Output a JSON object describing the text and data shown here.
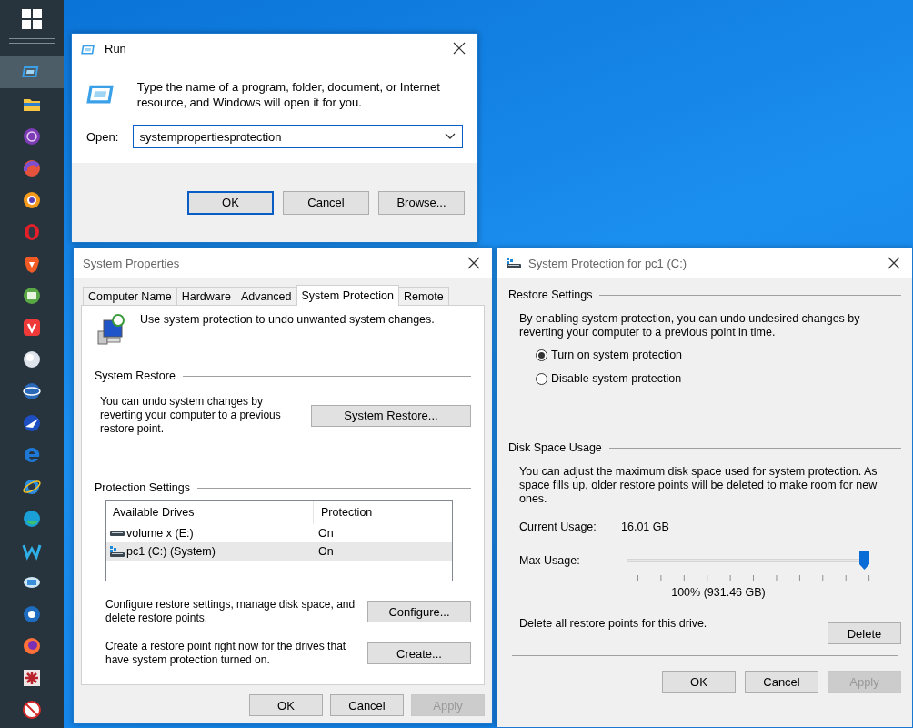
{
  "taskbar": {
    "items": [
      {
        "kind": "run",
        "selected": true
      },
      {
        "kind": "folder",
        "selected": false
      },
      {
        "kind": "tor",
        "selected": false
      },
      {
        "kind": "swirl",
        "selected": false
      },
      {
        "kind": "shield",
        "selected": false
      },
      {
        "kind": "opera",
        "selected": false
      },
      {
        "kind": "brave",
        "selected": false
      },
      {
        "kind": "tray",
        "selected": false
      },
      {
        "kind": "vivaldi",
        "selected": false
      },
      {
        "kind": "sphere",
        "selected": false
      },
      {
        "kind": "globe",
        "selected": false
      },
      {
        "kind": "plane",
        "selected": false
      },
      {
        "kind": "edge-old",
        "selected": false
      },
      {
        "kind": "ie",
        "selected": false
      },
      {
        "kind": "edge",
        "selected": false
      },
      {
        "kind": "w",
        "selected": false
      },
      {
        "kind": "disk",
        "selected": false
      },
      {
        "kind": "disc",
        "selected": false
      },
      {
        "kind": "firefox",
        "selected": false
      },
      {
        "kind": "bug",
        "selected": false
      },
      {
        "kind": "nosign",
        "selected": false
      }
    ]
  },
  "run_dialog": {
    "title": "Run",
    "description": "Type the name of a program, folder, document, or Internet resource, and Windows will open it for you.",
    "open_label": "Open:",
    "open_value": "systempropertiesprotection",
    "buttons": [
      {
        "label": "OK",
        "default": true,
        "disabled": false
      },
      {
        "label": "Cancel",
        "default": false,
        "disabled": false
      },
      {
        "label": "Browse...",
        "default": false,
        "disabled": false
      }
    ]
  },
  "system_properties": {
    "title": "System Properties",
    "tabs": [
      {
        "label": "Computer Name",
        "selected": false
      },
      {
        "label": "Hardware",
        "selected": false
      },
      {
        "label": "Advanced",
        "selected": false
      },
      {
        "label": "System Protection",
        "selected": true
      },
      {
        "label": "Remote",
        "selected": false
      }
    ],
    "intro": "Use system protection to undo unwanted system changes.",
    "system_restore": {
      "heading": "System Restore",
      "text": "You can undo system changes by reverting your computer to a previous restore point.",
      "button": "System Restore..."
    },
    "protection_settings": {
      "heading": "Protection Settings",
      "columns": [
        "Available Drives",
        "Protection"
      ],
      "rows": [
        {
          "kind": "drive",
          "name": "volume x (E:)",
          "protection": "On",
          "selected": false
        },
        {
          "kind": "system_drive",
          "name": "pc1 (C:) (System)",
          "protection": "On",
          "selected": true
        }
      ],
      "configure_text": "Configure restore settings, manage disk space, and delete restore points.",
      "configure_button": "Configure...",
      "create_text": "Create a restore point right now for the drives that have system protection turned on.",
      "create_button": "Create..."
    },
    "buttons": [
      {
        "label": "OK",
        "default": false,
        "disabled": false
      },
      {
        "label": "Cancel",
        "default": false,
        "disabled": false
      },
      {
        "label": "Apply",
        "default": false,
        "disabled": true
      }
    ]
  },
  "system_protection": {
    "title": "System Protection for pc1 (C:)",
    "restore_settings": {
      "heading": "Restore Settings",
      "text": "By enabling system protection, you can undo undesired changes by reverting your computer to a previous point in time.",
      "options": [
        {
          "label": "Turn on system protection",
          "selected": true
        },
        {
          "label": "Disable system protection",
          "selected": false
        }
      ]
    },
    "disk_space": {
      "heading": "Disk Space Usage",
      "text": "You can adjust the maximum disk space used for system protection. As space fills up, older restore points will be deleted to make room for new ones.",
      "current_label": "Current Usage:",
      "current_value": "16.01 GB",
      "max_label": "Max Usage:",
      "level": 1,
      "reading": "100% (931.46 GB)",
      "delete_text": "Delete all restore points for this drive.",
      "delete_button": "Delete"
    },
    "buttons": [
      {
        "label": "OK",
        "default": false,
        "disabled": false
      },
      {
        "label": "Cancel",
        "default": false,
        "disabled": false
      },
      {
        "label": "Apply",
        "default": false,
        "disabled": true
      }
    ]
  }
}
